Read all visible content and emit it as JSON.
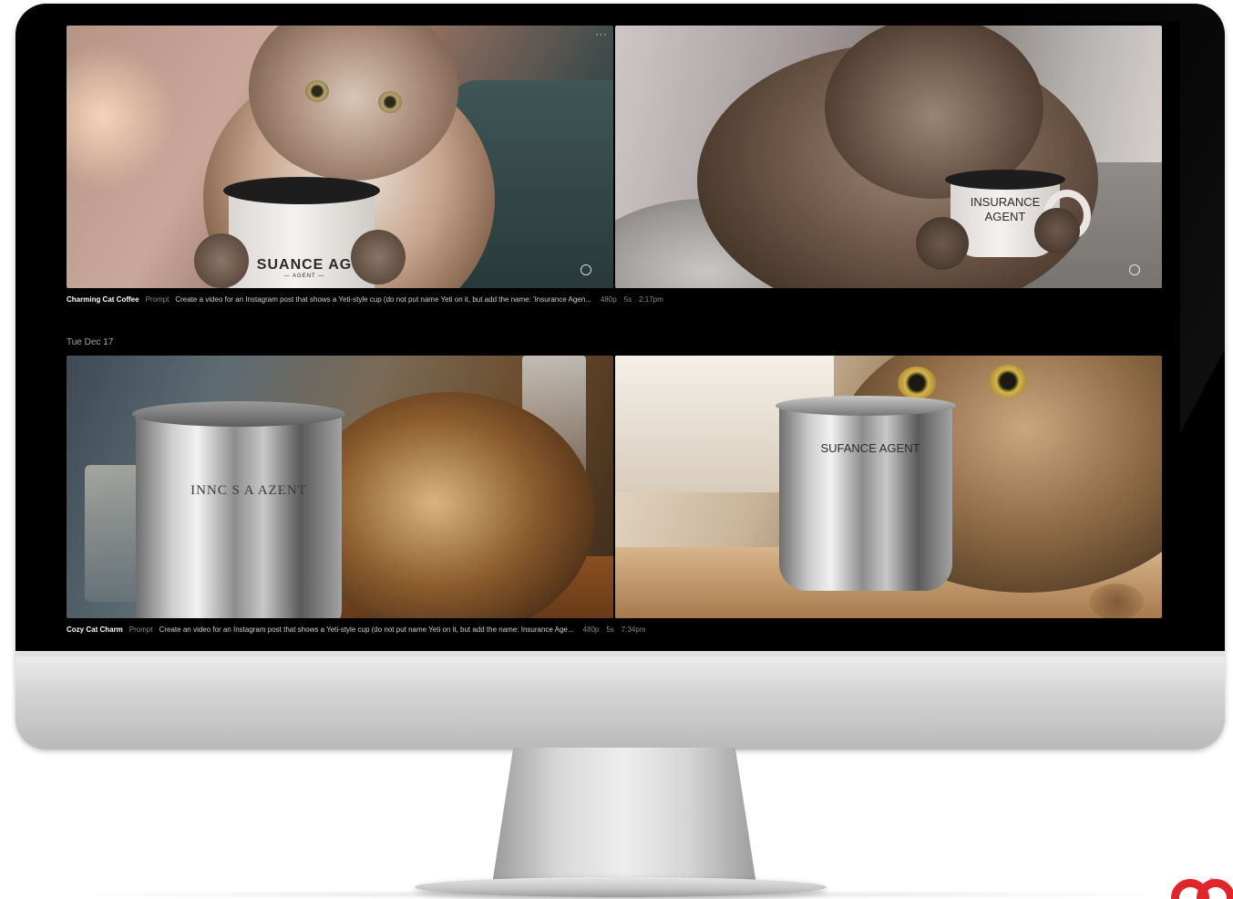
{
  "feed": {
    "groups": [
      {
        "date": "",
        "item": {
          "title": "Charming Cat Coffee",
          "prompt_label": "Prompt",
          "prompt": "Create a video for an Instagram post that shows a Yeti-style cup (do not put name Yeti on it, but add the name: 'Insurance Agen...",
          "resolution": "480p",
          "duration": "5s",
          "time": "2:17pm",
          "tiles": [
            {
              "cup_text_line1": "SUANCE AG",
              "cup_text_line2": "— AGENT —"
            },
            {
              "cup_text_line1": "INSURANCE",
              "cup_text_line2": "AGENT"
            }
          ]
        }
      },
      {
        "date": "Tue Dec 17",
        "item": {
          "title": "Cozy Cat Charm",
          "prompt_label": "Prompt",
          "prompt": "Create an video for an Instagram post that shows a Yeti-style cup (do not put name Yeti on it, but add the name: Insurance Age...",
          "resolution": "480p",
          "duration": "5s",
          "time": "7:34pm",
          "tiles": [
            {
              "cup_text_line1": "INNC S A AZENT"
            },
            {
              "cup_text_line1": "SUFANCE AGENT"
            }
          ]
        }
      }
    ]
  },
  "tile_menu": "···",
  "colors": {
    "bezel": "#000000",
    "frame": "#cfcfcf",
    "brand": "#e0262b"
  },
  "icons": [
    "more-options-icon",
    "watermark-icon",
    "registered-icon"
  ]
}
